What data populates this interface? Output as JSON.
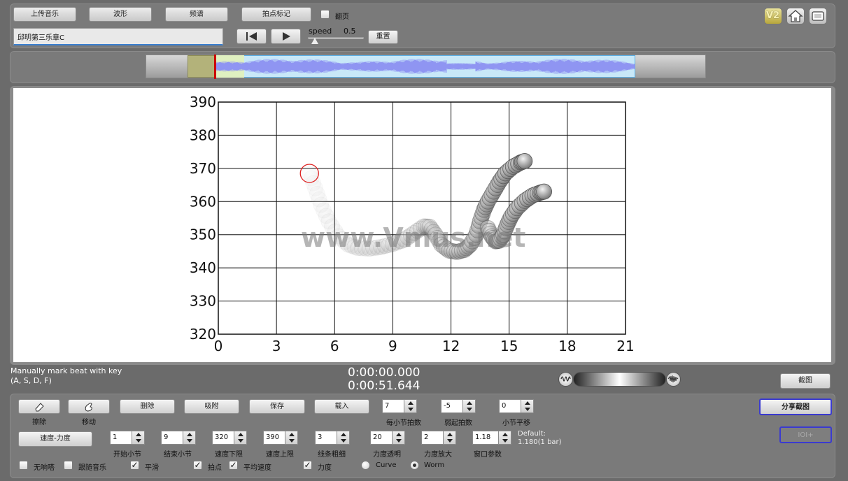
{
  "toolbar": {
    "upload_music": "上传音乐",
    "waveform": "波形",
    "spectrum": "频谱",
    "beat_mark": "拍点标记",
    "flip_page": "翻页",
    "track_name": "邱明第三乐章C",
    "speed_label": "speed",
    "speed_value": "0.5",
    "reset": "重置",
    "speed_fraction": 0.12
  },
  "top_icons": {
    "v2": "V2"
  },
  "colors": {
    "waveform": "#8f95f2",
    "cursor": "#cc0000",
    "circle": "#dd2222",
    "accent_border": "#3a3ad0"
  },
  "chart_data": {
    "type": "scatter",
    "style": "performance-worm",
    "x_ticks": [
      "0",
      "3",
      "6",
      "9",
      "12",
      "15",
      "18",
      "21"
    ],
    "y_ticks": [
      "320",
      "330",
      "340",
      "350",
      "360",
      "370",
      "380",
      "390"
    ],
    "xlim": [
      0,
      21
    ],
    "ylim": [
      320,
      390
    ],
    "grid": true,
    "current_marker": {
      "x": 4.7,
      "y": 368.5
    },
    "worm_path": [
      [
        4.7,
        368.5
      ],
      [
        5.0,
        364
      ],
      [
        5.3,
        359
      ],
      [
        5.7,
        354
      ],
      [
        6.2,
        349.5
      ],
      [
        6.7,
        347
      ],
      [
        7.2,
        346
      ],
      [
        7.8,
        345.8
      ],
      [
        8.4,
        346.3
      ],
      [
        9.0,
        347.2
      ],
      [
        9.6,
        348.5
      ],
      [
        10.1,
        350.5
      ],
      [
        10.6,
        352.5
      ],
      [
        10.9,
        352.4
      ],
      [
        11.2,
        350
      ],
      [
        11.5,
        347
      ],
      [
        11.9,
        345.2
      ],
      [
        12.3,
        344.8
      ],
      [
        12.7,
        345.4
      ],
      [
        13.0,
        347
      ],
      [
        13.3,
        350
      ],
      [
        13.5,
        354
      ],
      [
        13.7,
        357.5
      ],
      [
        13.9,
        360
      ],
      [
        14.2,
        363
      ],
      [
        14.5,
        366
      ],
      [
        14.8,
        368.5
      ],
      [
        15.2,
        370.5
      ],
      [
        15.6,
        371.8
      ],
      [
        15.8,
        372.2
      ]
    ],
    "worm_path_2": [
      [
        13.9,
        352
      ],
      [
        14.1,
        349.5
      ],
      [
        14.3,
        348
      ],
      [
        14.5,
        348.2
      ],
      [
        14.7,
        350
      ],
      [
        14.9,
        353
      ],
      [
        15.1,
        355.5
      ],
      [
        15.4,
        358
      ],
      [
        15.8,
        360.2
      ],
      [
        16.2,
        361.8
      ],
      [
        16.6,
        362.7
      ],
      [
        16.8,
        363
      ]
    ]
  },
  "watermark": "www.Vmus.net",
  "status": {
    "hint_line1": "Manually mark beat with key",
    "hint_line2": "(A, S, D, F)",
    "time_current": "0:00:00.000",
    "time_total": "0:00:51.644",
    "screenshot": "截图"
  },
  "tools": {
    "erase": "擦除",
    "move": "移动",
    "delete": "删除",
    "snap": "吸附",
    "save": "保存",
    "load": "载入",
    "tempo_dynamics": "速度-力度",
    "share_screenshot": "分享截图",
    "ioi": "IOI+"
  },
  "params": {
    "beats_per_bar": {
      "label": "每小节拍数",
      "value": "7"
    },
    "pickup_beats": {
      "label": "弱起拍数",
      "value": "-5"
    },
    "bar_offset": {
      "label": "小节平移",
      "value": "0"
    },
    "start_bar": {
      "label": "开始小节",
      "value": "1"
    },
    "end_bar": {
      "label": "结束小节",
      "value": "9"
    },
    "tempo_min": {
      "label": "速度下限",
      "value": "320"
    },
    "tempo_max": {
      "label": "速度上限",
      "value": "390"
    },
    "line_width": {
      "label": "线条粗细",
      "value": "3"
    },
    "dyn_opacity": {
      "label": "力度透明",
      "value": "20"
    },
    "dyn_scale": {
      "label": "力度放大",
      "value": "2"
    },
    "window_param": {
      "label": "窗口参数",
      "value": "1.18"
    },
    "default_line1": "Default:",
    "default_line2": "1.180(1 bar)"
  },
  "options": {
    "no_tick": "无响嗒",
    "follow_music": "跟随音乐",
    "smooth": "平滑",
    "beat_point": "拍点",
    "avg_tempo": "平均速度",
    "dynamics": "力度",
    "curve": "Curve",
    "worm": "Worm"
  }
}
